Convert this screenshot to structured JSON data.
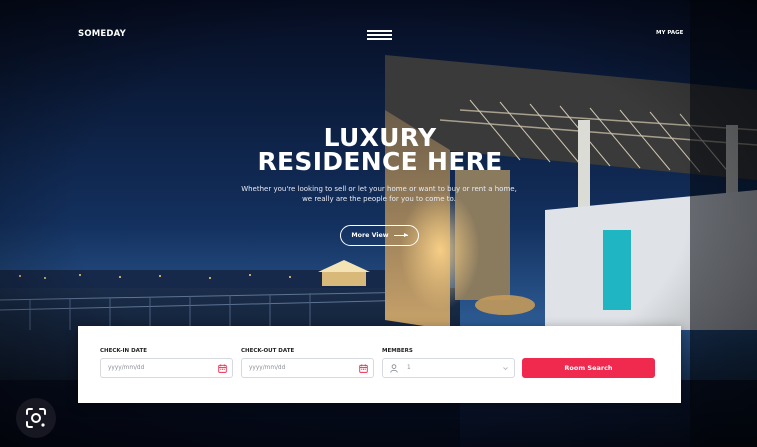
{
  "header": {
    "brand": "SOMEDAY",
    "menu_icon": "hamburger-menu-icon",
    "my_page": "MY PAGE"
  },
  "hero": {
    "title_line1": "LUXURY",
    "title_line2": "RESIDENCE HERE",
    "subtitle_line1": "Whether you're looking to  sell or let your home or want to buy or rent a home,",
    "subtitle_line2": "we really are the people for you to come to.",
    "more_button": "More View",
    "more_button_icon": "arrow-right-icon"
  },
  "booking": {
    "checkin_label": "CHECK-IN DATE",
    "checkin_placeholder": "yyyy/mm/dd",
    "checkout_label": "CHECK-OUT DATE",
    "checkout_placeholder": "yyyy/mm/dd",
    "members_label": "MEMBERS",
    "members_value": "1",
    "search_button": "Room Search",
    "calendar_icon": "calendar-icon",
    "person_icon": "person-icon",
    "dropdown_icon": "chevron-down-icon"
  },
  "overlay": {
    "lens_icon": "image-search-lens-icon"
  },
  "colors": {
    "accent": "#f0294f",
    "hero_dark": "#0b1a38",
    "panel_bg": "#ffffff"
  }
}
